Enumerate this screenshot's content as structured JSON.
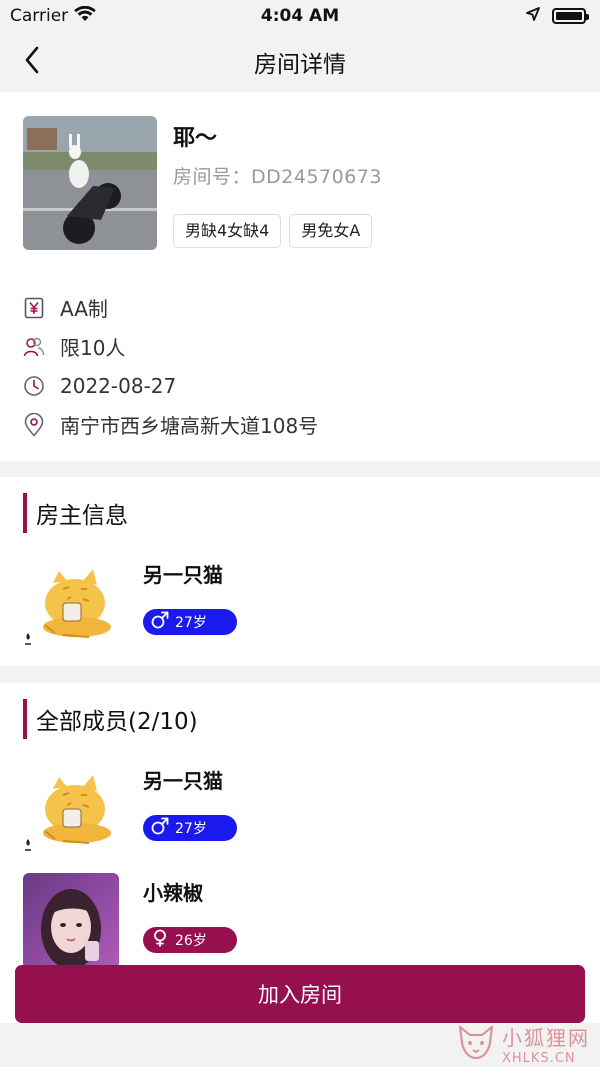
{
  "status_bar": {
    "carrier": "Carrier",
    "time": "4:04 AM"
  },
  "nav": {
    "title": "房间详情"
  },
  "room": {
    "name": "耶～",
    "room_no": "房间号：DD24570673",
    "tags": [
      "男缺4女缺4",
      "男免女A"
    ],
    "info": [
      {
        "icon": "yuan-icon",
        "text": "AA制"
      },
      {
        "icon": "people-icon",
        "text": "限10人"
      },
      {
        "icon": "clock-icon",
        "text": "2022-08-27"
      },
      {
        "icon": "location-pin-icon",
        "text": "南宁市西乡塘高新大道108号"
      }
    ]
  },
  "owner_section": {
    "title": "房主信息",
    "person": {
      "name": "另一只猫",
      "age": "27岁",
      "gender": "male"
    }
  },
  "members_section": {
    "title": "全部成员(2/10)",
    "members": [
      {
        "name": "另一只猫",
        "age": "27岁",
        "gender": "male"
      },
      {
        "name": "小辣椒",
        "age": "26岁",
        "gender": "female"
      }
    ]
  },
  "join_button": {
    "label": "加入房间"
  },
  "watermark": {
    "cn": "小狐狸网",
    "en": "XHLKS.CN"
  },
  "colors": {
    "accent": "#96104f",
    "male_badge": "#1a1aee",
    "background": "#f2f2f2"
  }
}
